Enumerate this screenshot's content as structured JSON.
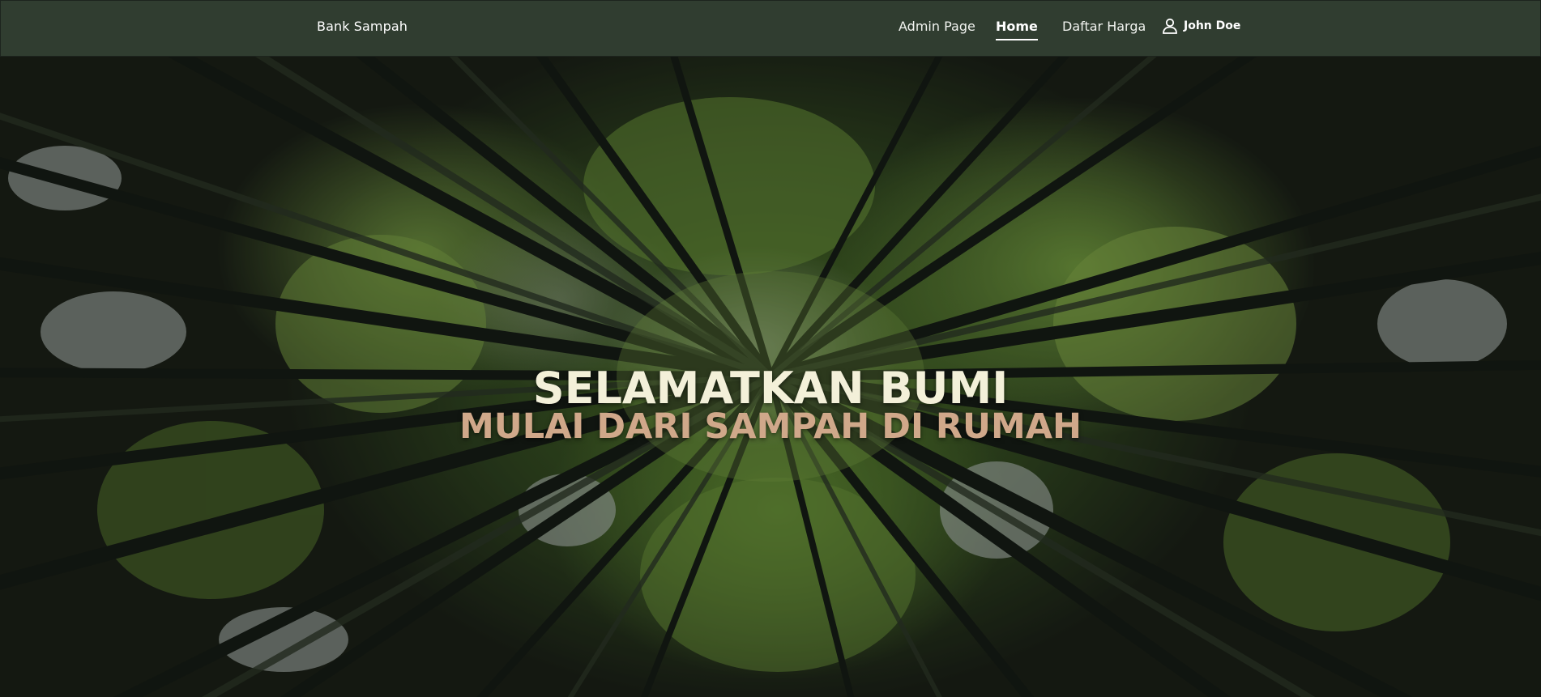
{
  "navbar": {
    "brand": "Bank Sampah",
    "links": [
      {
        "label": "Admin Page",
        "active": false
      },
      {
        "label": "Home",
        "active": true
      },
      {
        "label": "Daftar Harga",
        "active": false
      }
    ],
    "user": {
      "icon": "user-icon",
      "name": "John Doe"
    }
  },
  "hero": {
    "background": "bamboo-forest-photo",
    "title": "SELAMATKAN BUMI",
    "subtitle": "MULAI DARI SAMPAH DI RUMAH"
  },
  "colors": {
    "navbar_bg": "#303d30",
    "title": "#f3f0d9",
    "subtitle": "#d0a88a"
  }
}
